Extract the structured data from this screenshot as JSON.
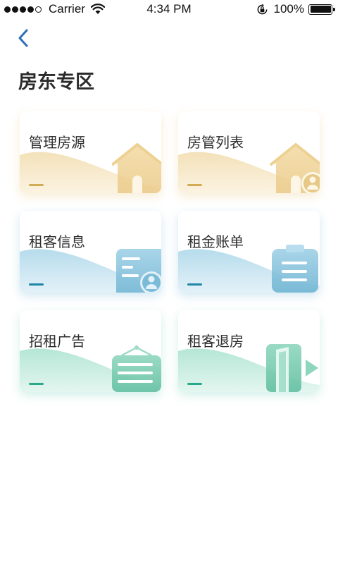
{
  "status_bar": {
    "carrier": "Carrier",
    "time": "4:34 PM",
    "battery": "100%"
  },
  "header": {
    "back_icon": "chevron-left-icon",
    "title": "房东专区"
  },
  "colors": {
    "accent": "#2c6fb7",
    "yellow_dash": "#d2ac55",
    "blue_dash": "#1f86a6",
    "green_dash": "#2aa98c"
  },
  "cards": [
    {
      "label": "管理房源",
      "theme": "yellow",
      "icon": "house-icon"
    },
    {
      "label": "房管列表",
      "theme": "yellow",
      "icon": "house-person-icon"
    },
    {
      "label": "租客信息",
      "theme": "blue",
      "icon": "profile-card-icon"
    },
    {
      "label": "租金账单",
      "theme": "blue",
      "icon": "clipboard-icon"
    },
    {
      "label": "招租广告",
      "theme": "green",
      "icon": "signboard-icon"
    },
    {
      "label": "租客退房",
      "theme": "green",
      "icon": "exit-door-icon"
    }
  ]
}
